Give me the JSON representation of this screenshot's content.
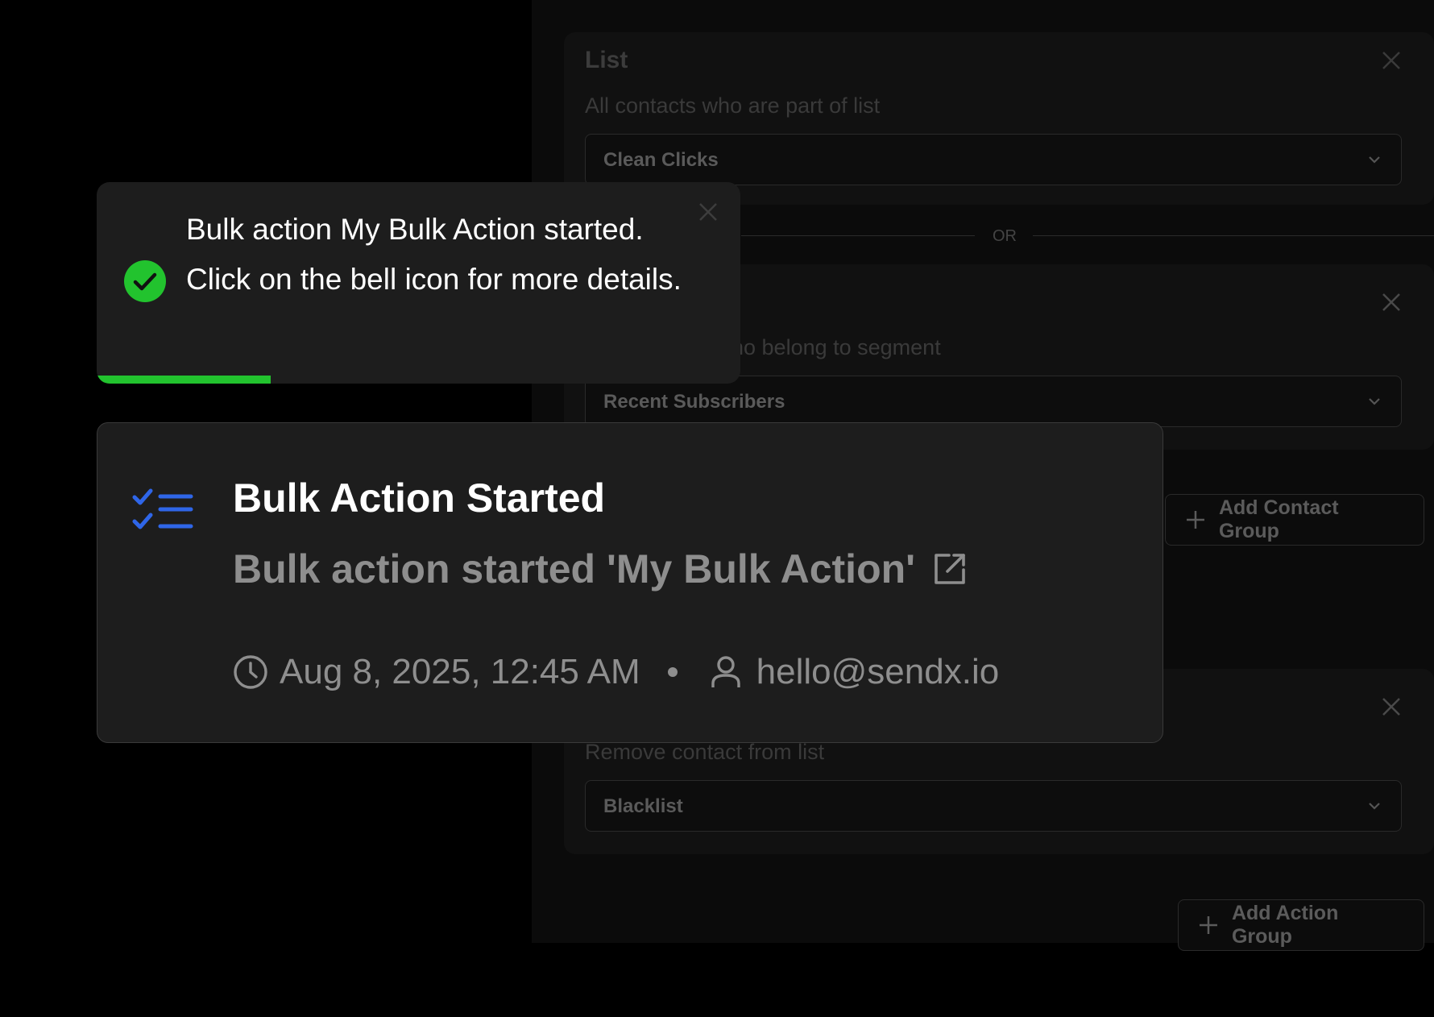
{
  "background": {
    "list_section": {
      "title": "List",
      "subtitle": "All contacts who are part of list",
      "selected": "Clean Clicks"
    },
    "or_separator": "OR",
    "segment_section": {
      "subtitle_fragment": "ho belong to segment",
      "selected": "Recent Subscribers"
    },
    "add_contact_group_label": "Add Contact Group",
    "action_section": {
      "subtitle": "Remove contact from list",
      "selected": "Blacklist"
    },
    "add_action_group_label": "Add Action Group"
  },
  "toast": {
    "message": "Bulk action My Bulk Action started. Click on the bell icon for more details.",
    "progress_percent": 27,
    "accent_color": "#22c32e",
    "icon": "check-circle-icon"
  },
  "notification": {
    "title": "Bulk Action Started",
    "description": "Bulk action started 'My Bulk Action'",
    "timestamp": "Aug 8, 2025, 12:45 AM",
    "user": "hello@sendx.io",
    "icon": "checklist-icon",
    "icon_color": "#2f66e8"
  }
}
